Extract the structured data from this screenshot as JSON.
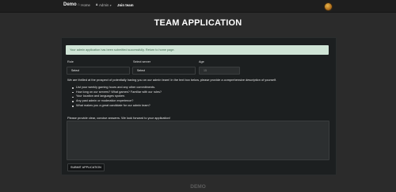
{
  "navbar": {
    "brand": "Demo",
    "home_label": "Home",
    "home_icon": "home-icon",
    "admin_label": "Admin",
    "admin_icon": "lock-icon",
    "join_label": "Join team"
  },
  "page": {
    "title": "TEAM APPLICATION"
  },
  "alert": {
    "text": "Your admin application has been submitted successfully. Return to home page.",
    "color": "#cfe4d6"
  },
  "form": {
    "role": {
      "label": "Role",
      "value": "Select"
    },
    "server": {
      "label": "Select server",
      "value": "Select"
    },
    "age": {
      "label": "Age",
      "placeholder": "15"
    },
    "intro": "We are thrilled at the prospect of potentially having you on our admin team! In the text box below, please provide a comprehensive description of yourself.",
    "bullets": [
      "List your weekly gaming hours and any other commitments.",
      "How long on our servers? What games? Familiar with our rules?",
      "Your location and languages spoken.",
      "Any past admin or moderation experience?",
      "What makes you a great candidate for our admin team?"
    ],
    "note": "Please provide clear, concise answers. We look forward to your application!",
    "submit_label": "SUBMIT APPLICATION"
  },
  "footer": {
    "text": "DEMO"
  }
}
